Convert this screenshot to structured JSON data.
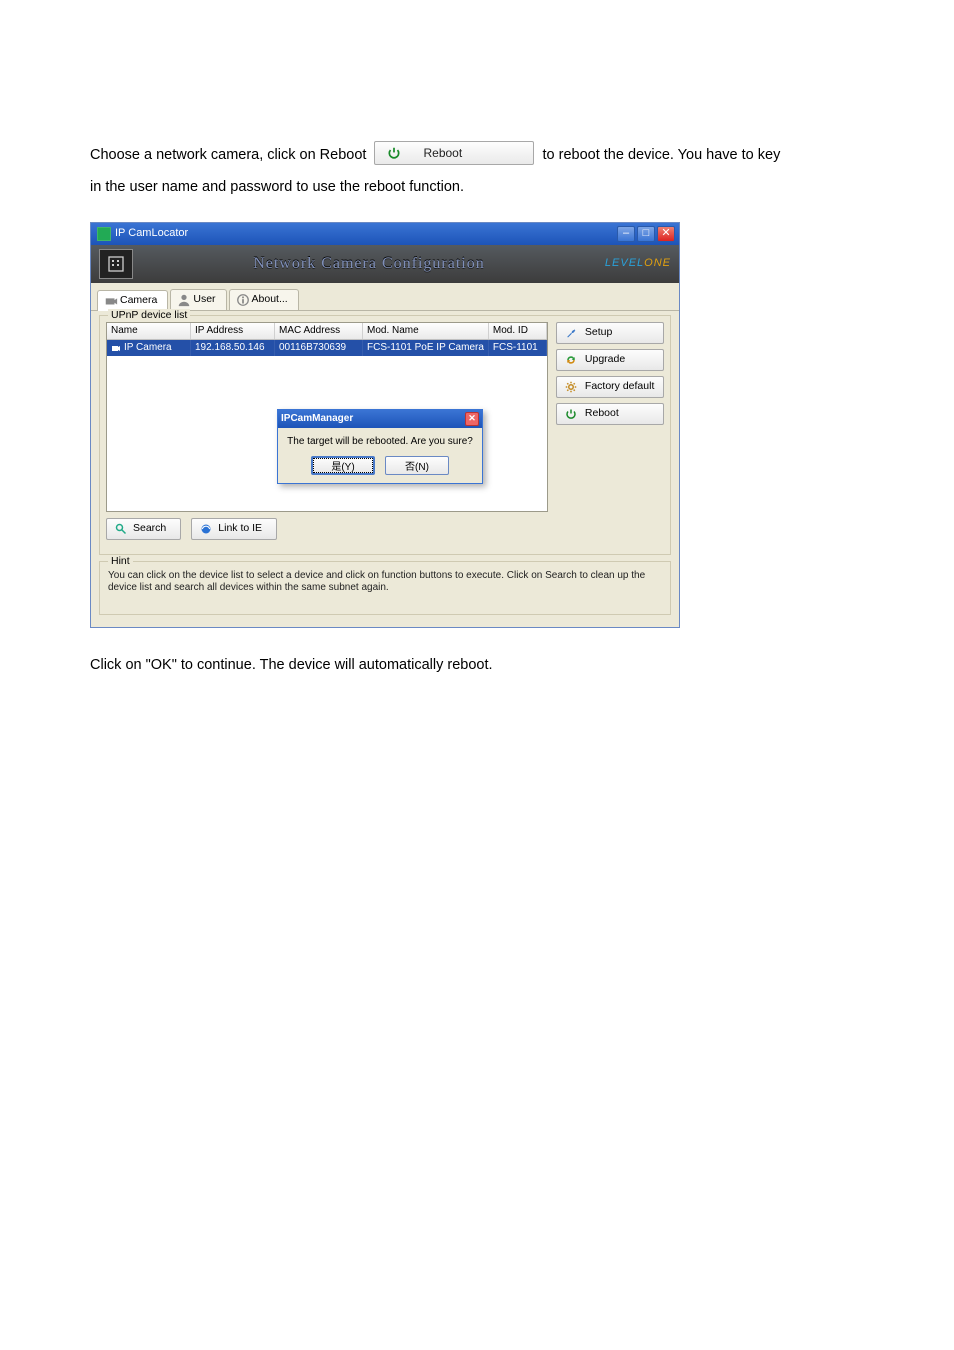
{
  "doc": {
    "line1a": "Choose a network camera, click on Reboot ",
    "reboot_btn_label": "Reboot",
    "line1b": " to reboot the device. You have to key",
    "line2": "in the user name and password to use the reboot function.",
    "line3": "Click on \"OK\" to continue. The device will automatically reboot."
  },
  "window": {
    "title": "IP CamLocator",
    "header_title": "Network Camera Configuration",
    "brand_a": "LEVEL",
    "brand_b": "ONE"
  },
  "tabs": {
    "camera": "Camera",
    "user": "User",
    "about": "About..."
  },
  "group": {
    "legend": "UPnP device list"
  },
  "columns": {
    "name": "Name",
    "ip": "IP Address",
    "mac": "MAC Address",
    "modname": "Mod. Name",
    "modid": "Mod. ID"
  },
  "row": {
    "name": "IP Camera",
    "ip": "192.168.50.146",
    "mac": "00116B730639",
    "modname": "FCS-1101 PoE IP Camera",
    "modid": "FCS-1101"
  },
  "side": {
    "setup": "Setup",
    "upgrade": "Upgrade",
    "factory": "Factory default",
    "reboot": "Reboot"
  },
  "tools": {
    "search": "Search",
    "link": "Link to IE"
  },
  "hint": {
    "legend": "Hint",
    "text": "You can click on the device list to select a device and click on function buttons to execute. Click on Search to clean up the device list and search all devices within the same subnet again."
  },
  "modal": {
    "title": "IPCamManager",
    "msg": "The target will be rebooted. Are you sure?",
    "ok": "是(Y)",
    "no": "否(N)"
  }
}
